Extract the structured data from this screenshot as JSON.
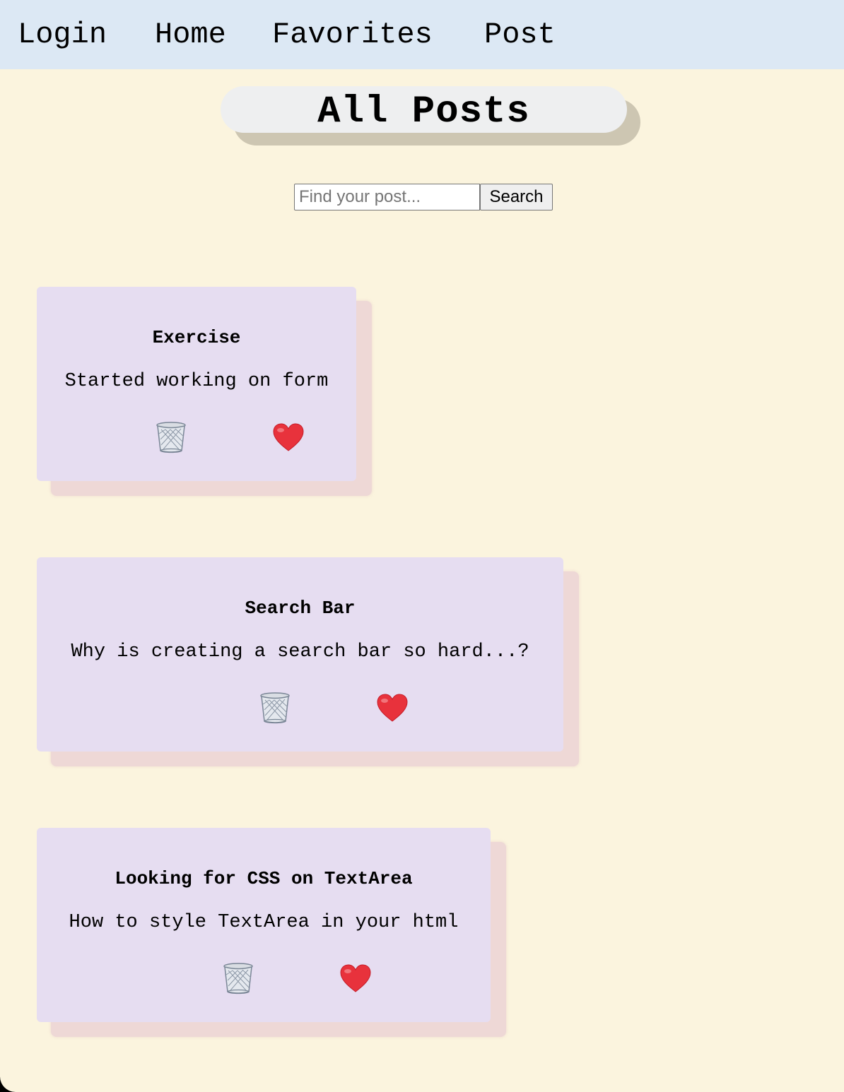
{
  "nav": {
    "links": [
      {
        "label": "Login"
      },
      {
        "label": "Home"
      },
      {
        "label": "Favorites"
      },
      {
        "label": "Post"
      }
    ]
  },
  "page": {
    "title": "All Posts"
  },
  "search": {
    "placeholder": "Find your post...",
    "value": "",
    "button_label": "Search"
  },
  "posts": [
    {
      "title": "Exercise",
      "body": "Started working on form",
      "delete_icon": "trash-icon",
      "favorite_icon": "heart-icon"
    },
    {
      "title": "Search Bar",
      "body": "Why is creating a search bar so hard...?",
      "delete_icon": "trash-icon",
      "favorite_icon": "heart-icon"
    },
    {
      "title": "Looking for CSS on TextArea",
      "body": "How to style TextArea in your html",
      "delete_icon": "trash-icon",
      "favorite_icon": "heart-icon"
    }
  ],
  "colors": {
    "page_background": "#fbf4de",
    "navbar_background": "#dce8f4",
    "title_pill": "#eeeff0",
    "title_shadow": "#cdc6b2",
    "card_background": "#e6ddf1",
    "card_shadow": "#eed8d6",
    "heart": "#e8323c"
  }
}
